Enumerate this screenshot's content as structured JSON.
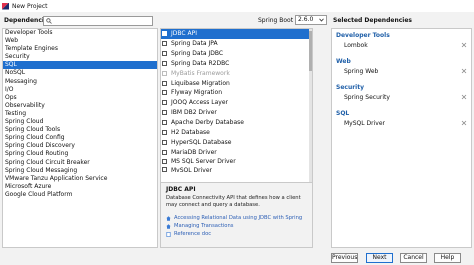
{
  "window": {
    "title": "New Project"
  },
  "top": {
    "dependencies_label": "Dependencies",
    "search_value": "",
    "spring_boot_label": "Spring Boot",
    "spring_boot_version": "2.6.0",
    "selected_label": "Selected Dependencies"
  },
  "categories": [
    {
      "label": "Developer Tools",
      "selected": false
    },
    {
      "label": "Web",
      "selected": false
    },
    {
      "label": "Template Engines",
      "selected": false
    },
    {
      "label": "Security",
      "selected": false
    },
    {
      "label": "SQL",
      "selected": true
    },
    {
      "label": "NoSQL",
      "selected": false
    },
    {
      "label": "Messaging",
      "selected": false
    },
    {
      "label": "I/O",
      "selected": false
    },
    {
      "label": "Ops",
      "selected": false
    },
    {
      "label": "Observability",
      "selected": false
    },
    {
      "label": "Testing",
      "selected": false
    },
    {
      "label": "Spring Cloud",
      "selected": false
    },
    {
      "label": "Spring Cloud Tools",
      "selected": false
    },
    {
      "label": "Spring Cloud Config",
      "selected": false
    },
    {
      "label": "Spring Cloud Discovery",
      "selected": false
    },
    {
      "label": "Spring Cloud Routing",
      "selected": false
    },
    {
      "label": "Spring Cloud Circuit Breaker",
      "selected": false
    },
    {
      "label": "Spring Cloud Messaging",
      "selected": false
    },
    {
      "label": "VMware Tanzu Application Service",
      "selected": false
    },
    {
      "label": "Microsoft Azure",
      "selected": false
    },
    {
      "label": "Google Cloud Platform",
      "selected": false
    }
  ],
  "dependencies": [
    {
      "label": "JDBC API",
      "selected": true,
      "disabled": false
    },
    {
      "label": "Spring Data JPA",
      "selected": false,
      "disabled": false
    },
    {
      "label": "Spring Data JDBC",
      "selected": false,
      "disabled": false
    },
    {
      "label": "Spring Data R2DBC",
      "selected": false,
      "disabled": false
    },
    {
      "label": "MyBatis Framework",
      "selected": false,
      "disabled": true
    },
    {
      "label": "Liquibase Migration",
      "selected": false,
      "disabled": false
    },
    {
      "label": "Flyway Migration",
      "selected": false,
      "disabled": false
    },
    {
      "label": "JOOQ Access Layer",
      "selected": false,
      "disabled": false
    },
    {
      "label": "IBM DB2 Driver",
      "selected": false,
      "disabled": false
    },
    {
      "label": "Apache Derby Database",
      "selected": false,
      "disabled": false
    },
    {
      "label": "H2 Database",
      "selected": false,
      "disabled": false
    },
    {
      "label": "HyperSQL Database",
      "selected": false,
      "disabled": false
    },
    {
      "label": "MariaDB Driver",
      "selected": false,
      "disabled": false
    },
    {
      "label": "MS SQL Server Driver",
      "selected": false,
      "disabled": false
    },
    {
      "label": "MySQL Driver",
      "selected": false,
      "disabled": false
    }
  ],
  "description": {
    "title": "JDBC API",
    "text": "Database Connectivity API that defines how a client may connect and query a database.",
    "links": [
      {
        "label": "Accessing Relational Data using JDBC with Spring",
        "icon": "house-icon"
      },
      {
        "label": "Managing Transactions",
        "icon": "house-icon"
      },
      {
        "label": "Reference doc",
        "icon": "doc-icon"
      }
    ]
  },
  "selected_groups": [
    {
      "group": "Developer Tools",
      "items": [
        "Lombok"
      ]
    },
    {
      "group": "Web",
      "items": [
        "Spring Web"
      ]
    },
    {
      "group": "Security",
      "items": [
        "Spring Security"
      ]
    },
    {
      "group": "SQL",
      "items": [
        "MySQL Driver"
      ]
    }
  ],
  "buttons": {
    "previous": "Previous",
    "next": "Next",
    "cancel": "Cancel",
    "help": "Help"
  },
  "colors": {
    "selection": "#1f6fce",
    "group_title": "#1f5fa8",
    "link": "#2b5eb5"
  }
}
